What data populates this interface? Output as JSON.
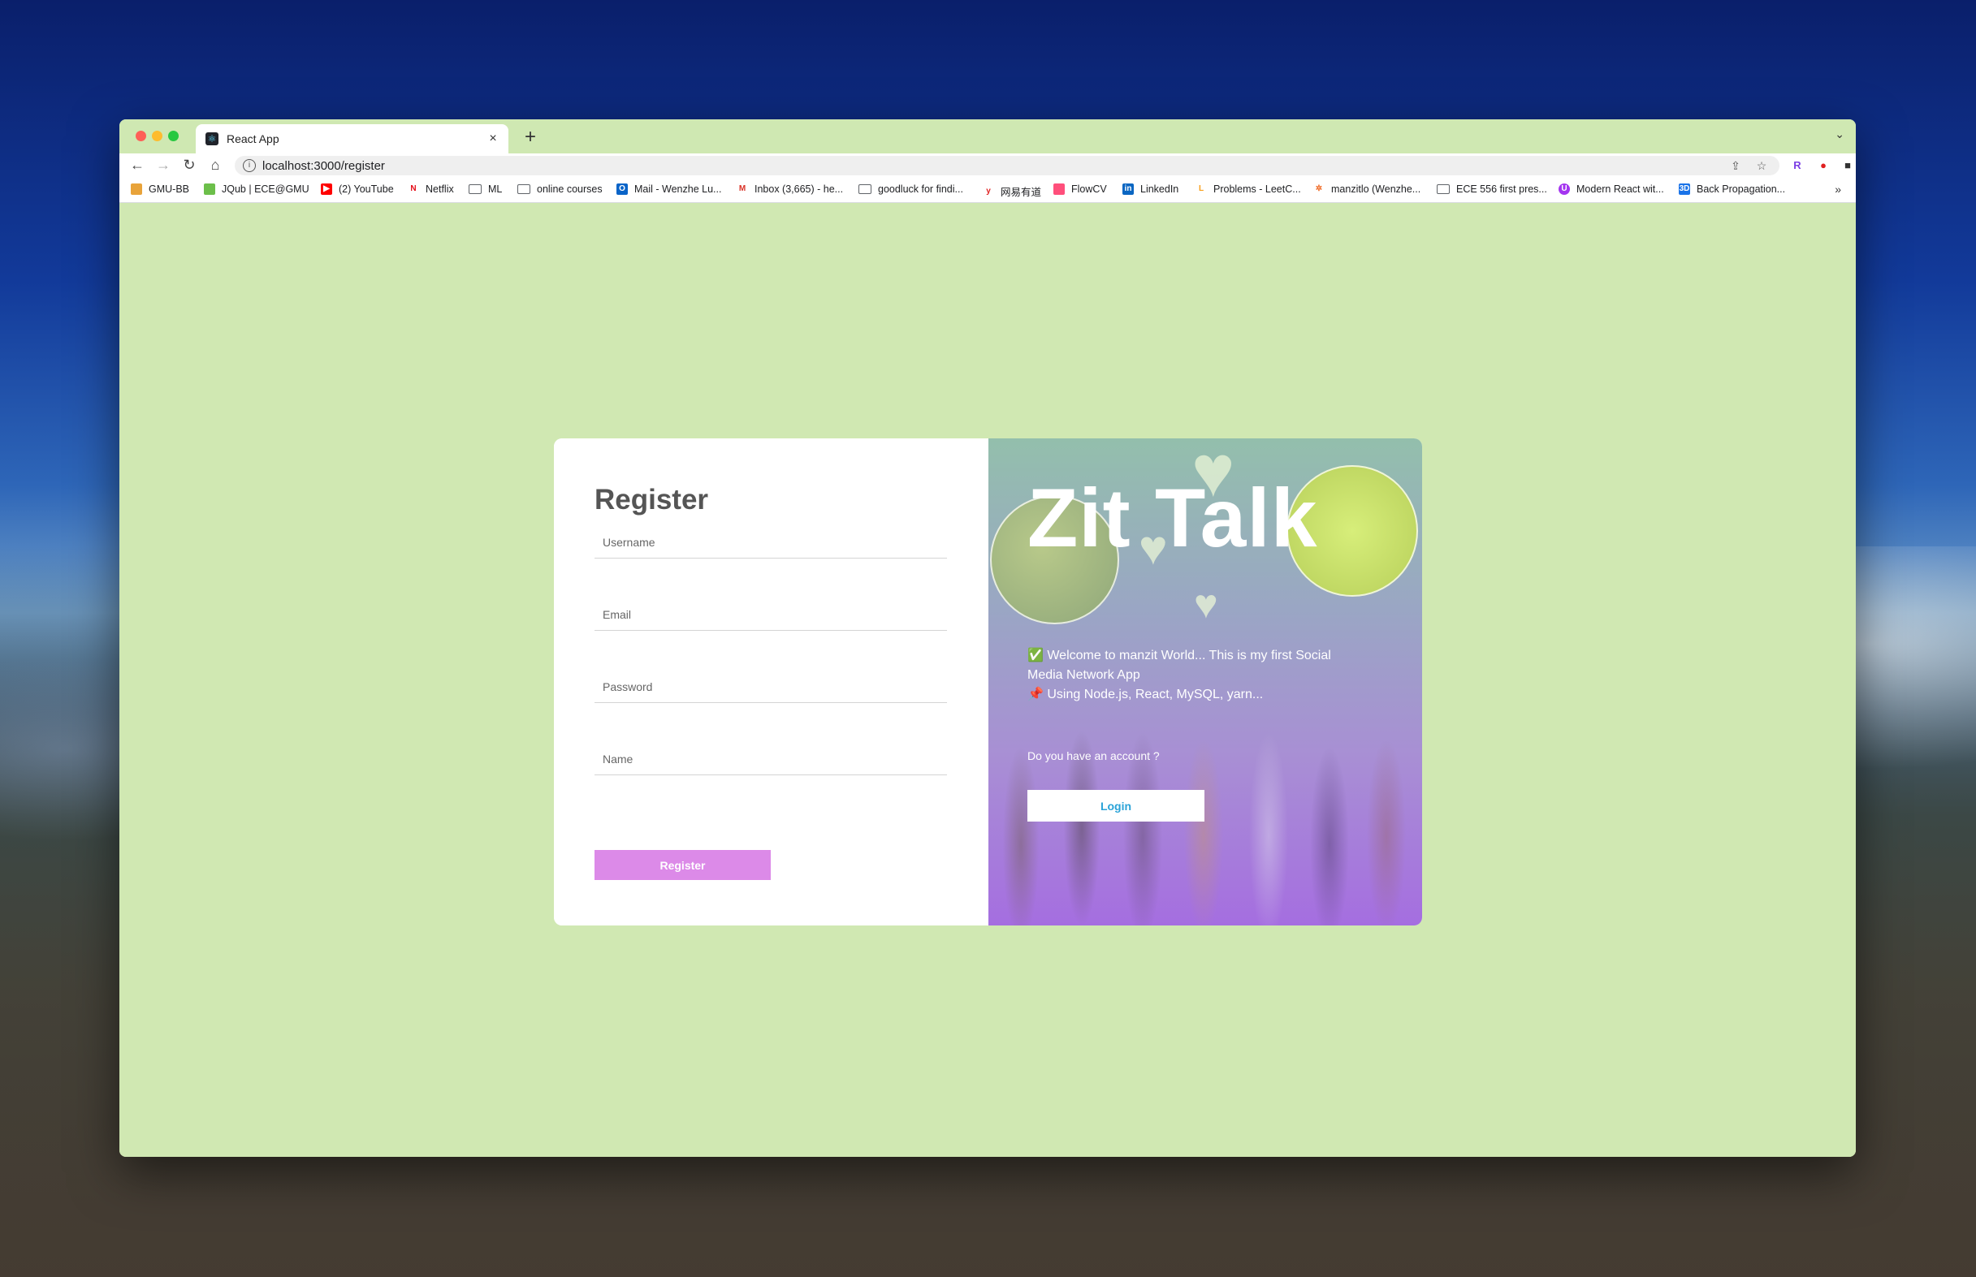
{
  "browser": {
    "tab_title": "React App",
    "tab_close": "×",
    "new_tab": "+",
    "url": "localhost:3000/register",
    "extensions": [
      "R",
      "●",
      "■",
      "✦",
      "▣",
      "☺",
      "⋮"
    ],
    "bookmarks": [
      {
        "label": "GMU-BB",
        "icon": "gmu-icon"
      },
      {
        "label": "JQub | ECE@GMU",
        "icon": "jqub-icon"
      },
      {
        "label": "(2) YouTube",
        "icon": "youtube-icon"
      },
      {
        "label": "Netflix",
        "icon": "netflix-icon"
      },
      {
        "label": "ML",
        "icon": "folder-icon"
      },
      {
        "label": "online courses",
        "icon": "folder-icon"
      },
      {
        "label": "Mail - Wenzhe Lu...",
        "icon": "outlook-icon"
      },
      {
        "label": "Inbox (3,665) - he...",
        "icon": "gmail-icon"
      },
      {
        "label": "goodluck for findi...",
        "icon": "folder-icon"
      },
      {
        "label": "网易有道",
        "icon": "youdao-icon"
      },
      {
        "label": "FlowCV",
        "icon": "flowcv-icon"
      },
      {
        "label": "LinkedIn",
        "icon": "linkedin-icon"
      },
      {
        "label": "Problems - LeetC...",
        "icon": "leetcode-icon"
      },
      {
        "label": "manzitlo (Wenzhe...",
        "icon": "manzitlo-icon"
      },
      {
        "label": "ECE 556 first pres...",
        "icon": "folder-icon"
      },
      {
        "label": "Modern React wit...",
        "icon": "udemy-icon"
      },
      {
        "label": "Back Propagation...",
        "icon": "3d-icon"
      }
    ],
    "bookmarks_more": "»"
  },
  "register": {
    "title": "Register",
    "username_placeholder": "Username",
    "email_placeholder": "Email",
    "password_placeholder": "Password",
    "name_placeholder": "Name",
    "button_label": "Register"
  },
  "promo": {
    "title": "Zit Talk",
    "line1": "✅ Welcome to manzit World... This is my first Social Media Network App",
    "line2": "📌 Using Node.js, React, MySQL, yarn...",
    "question": "Do you have an account ?",
    "login_label": "Login"
  },
  "colors": {
    "page_background": "#d0e8b2",
    "register_button": "#dc8ae8",
    "login_text": "#2aa3d8",
    "title_text": "#555555"
  }
}
